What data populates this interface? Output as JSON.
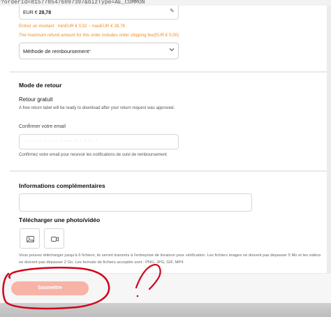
{
  "browser": {
    "url_fragment": "?orderId=8157785476097397&bizType=AE_COMMON"
  },
  "refund": {
    "amount_currency": "EUR €",
    "amount_value": "28,78",
    "min_max_hint": "Entrez un montant : minEUR € 0,02 ~ maxEUR € 28,78",
    "shipping_hint": "The maximum refund amount for this order includes order shipping fee(EUR € 0,00)",
    "method_label": "Méthode de remboursement",
    "method_required_mark": "*"
  },
  "return_mode": {
    "title": "Mode de retour",
    "subtitle": "Retour gratuit",
    "description": "A free return label will be ready to download after your return request was approved.",
    "email_label": "Confirmer votre email",
    "email_value": "·  ·  · ·  ·  · ·  ·  · · ·.·· ··  ·  ·  ·  · ·",
    "email_note": "Confirmez votre email pour recevoir les notifications de suivi de remboursement"
  },
  "additional": {
    "title": "Informations complémentaires",
    "upload_title": "Télécharger une photo/vidéo",
    "upload_note_line1": "Vous pouvez télécharger jusqu'à 6 fichiers, ils seront transmis à l'entreprise de livraison pour vérification. Les fichiers images ne doivent pas dépasser 5 Mo et les vidéos",
    "upload_note_line2": "ne doivent pas dépasser 2 Go. Les formats de fichiers acceptés sont : PNG, JPG, GIF, MP4"
  },
  "actions": {
    "submit_label": "Soumettre"
  },
  "colors": {
    "warning_orange": "#f08a1c",
    "submit_disabled": "#f7b4a6",
    "annotation_red": "#d0021b"
  },
  "icons": [
    "edit-icon",
    "chevron-down-icon",
    "image-icon",
    "video-icon"
  ]
}
